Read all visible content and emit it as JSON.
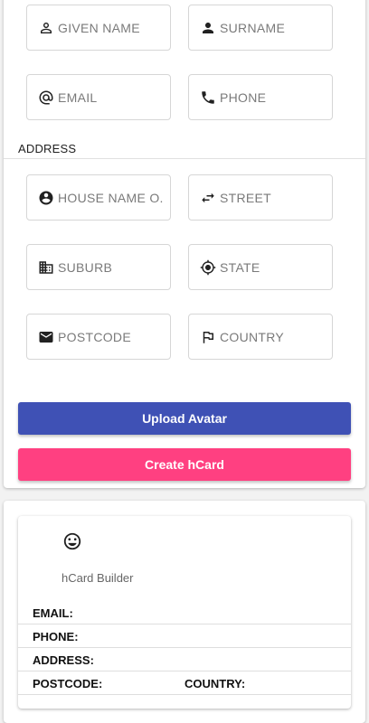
{
  "form": {
    "fields": {
      "given_name": {
        "placeholder": "GIVEN NAME",
        "icon": "person-outline-icon"
      },
      "surname": {
        "placeholder": "SURNAME",
        "icon": "person-icon"
      },
      "email": {
        "placeholder": "EMAIL",
        "icon": "at-sign-icon"
      },
      "phone": {
        "placeholder": "PHONE",
        "icon": "phone-icon"
      },
      "house_name": {
        "placeholder": "HOUSE NAME O...",
        "icon": "account-circle-icon"
      },
      "street": {
        "placeholder": "STREET",
        "icon": "swap-horiz-icon"
      },
      "suburb": {
        "placeholder": "SUBURB",
        "icon": "business-icon"
      },
      "state": {
        "placeholder": "STATE",
        "icon": "target-icon"
      },
      "postcode": {
        "placeholder": "POSTCODE",
        "icon": "mail-icon"
      },
      "country": {
        "placeholder": "COUNTRY",
        "icon": "flag-icon"
      }
    },
    "address_label": "ADDRESS",
    "upload_label": "Upload Avatar",
    "create_label": "Create hCard"
  },
  "preview": {
    "avatar_icon": "smiley-face-icon",
    "name": "hCard Builder",
    "email_label": "EMAIL:",
    "phone_label": "PHONE:",
    "address_label": "ADDRESS:",
    "postcode_label": "POSTCODE:",
    "country_label": "COUNTRY:"
  },
  "colors": {
    "primary": "#3f51b5",
    "accent": "#ff4081"
  }
}
